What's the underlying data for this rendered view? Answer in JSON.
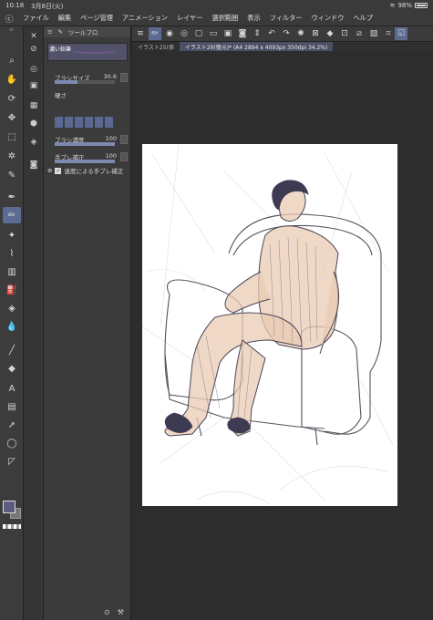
{
  "status": {
    "time": "10:18",
    "date": "3月8日(火)",
    "battery": "98%"
  },
  "menu": [
    "ファイル",
    "編集",
    "ページ管理",
    "アニメーション",
    "レイヤー",
    "選択範囲",
    "表示",
    "フィルター",
    "ウィンドウ",
    "ヘルプ"
  ],
  "tool_panel": {
    "tab_label": "ツールプロ",
    "brush_name": "濃い鉛筆",
    "brush_size_label": "ブラシサイズ",
    "brush_size_value": "30.6",
    "brush_size_fill": 0.38,
    "hardness_label": "硬さ",
    "density_label": "ブラシ濃度",
    "density_value": "100",
    "density_fill": 1.0,
    "stabilization_label": "手ブレ補正",
    "stabilization_value": "100",
    "stabilization_fill": 1.0,
    "speed_stabilization_label": "速度による手ブレ補正"
  },
  "tabs": [
    {
      "label": "イラスト25(保",
      "active": false
    },
    {
      "label": "イラスト29(復元)* (A4 2894 x 4093px 350dpi 34.2%)",
      "active": true
    }
  ],
  "colors": {
    "main_color": "#5d5a80",
    "accent": "#5d6b93",
    "ui_bg": "#3b3b3b",
    "canvas_bg": "#2d2d2d"
  },
  "icons": {
    "app_logo": "clip-studio-logo-icon",
    "tools": [
      "magnifier-icon",
      "hand-icon",
      "rotate-icon",
      "move-icon",
      "select-rect-icon",
      "magic-wand-icon",
      "eyedropper-icon",
      "pen-icon",
      "pencil-icon",
      "brush-icon",
      "airbrush-icon",
      "gradient-icon",
      "fill-icon",
      "eraser-icon",
      "blend-icon",
      "line-icon",
      "fill-bucket-icon",
      "text-icon",
      "frame-icon",
      "object-select-icon",
      "lasso-icon",
      "ruler-icon"
    ]
  }
}
